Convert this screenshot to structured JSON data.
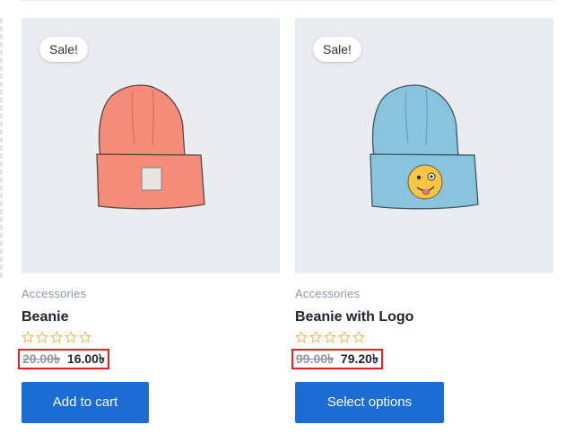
{
  "products": [
    {
      "sale_badge": "Sale!",
      "category": "Accessories",
      "name": "Beanie",
      "rating": 0,
      "rating_max": 5,
      "regular_price": "20.00৳",
      "sale_price": "16.00৳",
      "button_label": "Add to cart",
      "hat_color": "#f58c79",
      "icon": "beanie-red-image"
    },
    {
      "sale_badge": "Sale!",
      "category": "Accessories",
      "name": "Beanie with Logo",
      "rating": 0,
      "rating_max": 5,
      "regular_price": "99.00৳",
      "sale_price": "79.20৳",
      "button_label": "Select options",
      "hat_color": "#88c4dd",
      "icon": "beanie-blue-logo-image"
    }
  ],
  "colors": {
    "accent": "#1c6cd6",
    "highlight_border": "#ec1c24",
    "star": "#f0ad4e",
    "image_bg": "#e9edf1"
  }
}
